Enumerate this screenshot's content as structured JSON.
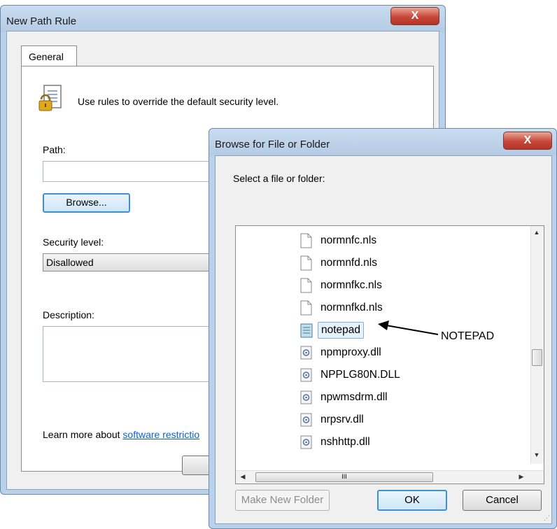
{
  "path_rule_window": {
    "title": "New Path Rule",
    "close_label": "X",
    "tab_label": "General",
    "info_text": "Use rules to override the default security level.",
    "path_label": "Path:",
    "path_value": "",
    "browse_label": "Browse...",
    "security_label": "Security level:",
    "security_value": "Disallowed",
    "description_label": "Description:",
    "description_value": "",
    "learn_more_prefix": "Learn more about ",
    "learn_more_link": "software restrictio",
    "lock_icon": "lock-document-icon"
  },
  "browse_dialog": {
    "title": "Browse for File or Folder",
    "close_label": "X",
    "prompt": "Select a file or folder:",
    "items": [
      {
        "name": "normnfc.nls",
        "icon": "file-icon"
      },
      {
        "name": "normnfd.nls",
        "icon": "file-icon"
      },
      {
        "name": "normnfkc.nls",
        "icon": "file-icon"
      },
      {
        "name": "normnfkd.nls",
        "icon": "file-icon"
      },
      {
        "name": "notepad",
        "icon": "notepad-icon",
        "selected": true
      },
      {
        "name": "npmproxy.dll",
        "icon": "dll-icon"
      },
      {
        "name": "NPPLG80N.DLL",
        "icon": "dll-icon"
      },
      {
        "name": "npwmsdrm.dll",
        "icon": "dll-icon"
      },
      {
        "name": "nrpsrv.dll",
        "icon": "dll-icon"
      },
      {
        "name": "nshhttp.dll",
        "icon": "dll-icon"
      }
    ],
    "hscroll_grip": "III",
    "make_folder_label": "Make New Folder",
    "ok_label": "OK",
    "cancel_label": "Cancel"
  },
  "annotation": {
    "text": "NOTEPAD"
  }
}
